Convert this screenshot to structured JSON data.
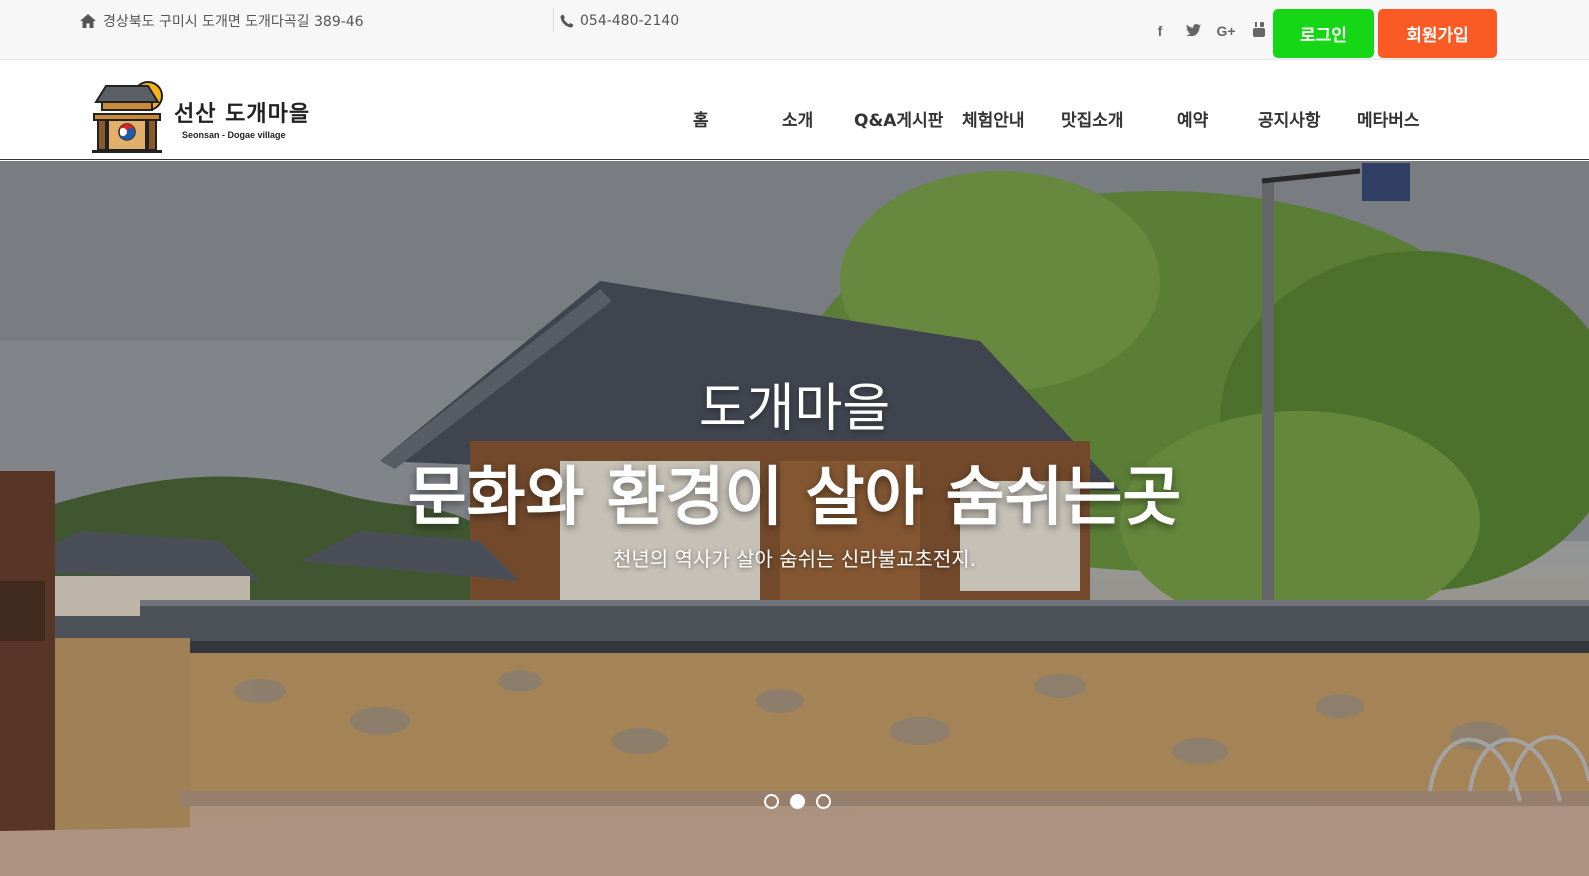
{
  "topbar": {
    "address": "경상북도 구미시 도개면 도개다곡길 389-46",
    "phone": "054-480-2140",
    "social": [
      {
        "name": "facebook-icon",
        "glyph": "f"
      },
      {
        "name": "twitter-icon",
        "glyph": "🐦"
      },
      {
        "name": "google-plus-icon",
        "glyph": "G+"
      },
      {
        "name": "youtube-icon",
        "glyph": "▶"
      }
    ],
    "login_label": "로그인",
    "join_label": "회원가입",
    "login_color": "#16d716",
    "join_color": "#fa5a24"
  },
  "logo": {
    "title": "선산 도개마을",
    "subtitle": "Seonsan - Dogae village"
  },
  "nav": {
    "items": [
      "홈",
      "소개",
      "Q&A게시판",
      "체험안내",
      "맛집소개",
      "예약",
      "공지사항",
      "메타버스"
    ]
  },
  "hero": {
    "title": "도개마을",
    "headline": "문화와 환경이 살아 숨쉬는곳",
    "subtitle": "천년의 역사가 살아 숨쉬는 신라불교초전지.",
    "active_slide": 2,
    "slide_count": 3
  }
}
